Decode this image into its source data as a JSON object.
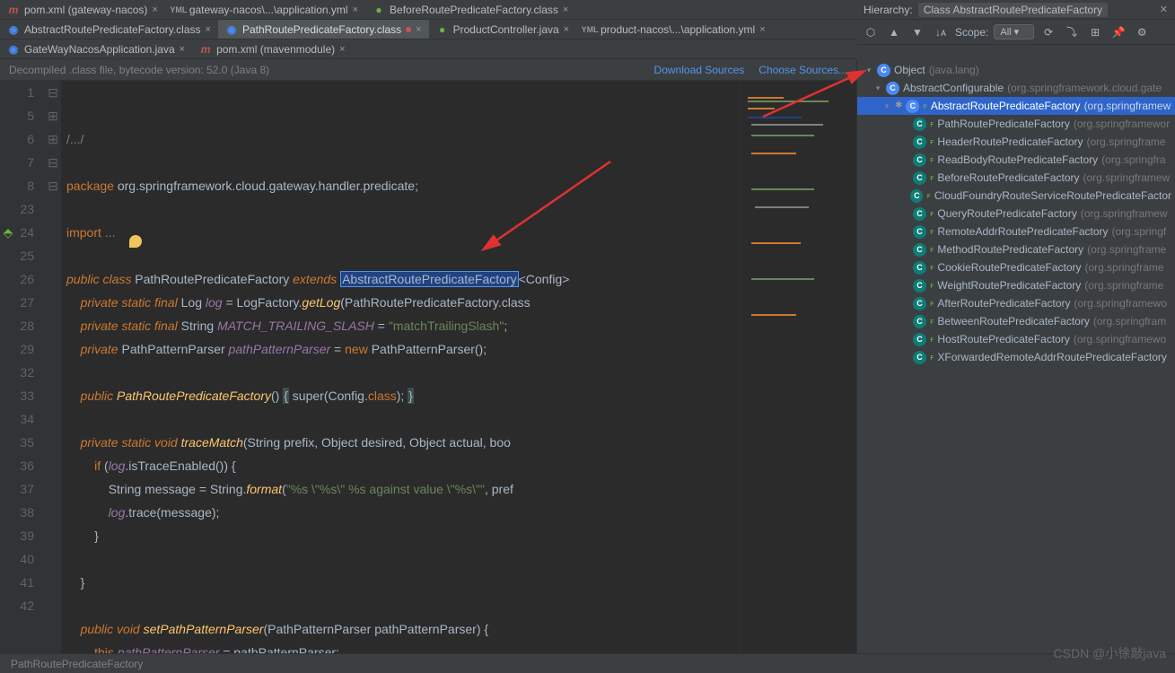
{
  "tabs_row1": [
    {
      "label": "pom.xml (gateway-nacos)",
      "icon": "m",
      "active": false
    },
    {
      "label": "gateway-nacos\\...\\application.yml",
      "icon": "y",
      "active": false
    },
    {
      "label": "BeforeRoutePredicateFactory.class",
      "icon": "j",
      "active": false
    }
  ],
  "tabs_row2": [
    {
      "label": "AbstractRoutePredicateFactory.class",
      "icon": "g",
      "active": false
    },
    {
      "label": "PathRoutePredicateFactory.class",
      "icon": "g",
      "active": true,
      "pinned": true
    },
    {
      "label": "ProductController.java",
      "icon": "j",
      "active": false
    },
    {
      "label": "product-nacos\\...\\application.yml",
      "icon": "y",
      "active": false
    }
  ],
  "tabs_row3": [
    {
      "label": "GateWayNacosApplication.java",
      "icon": "g",
      "active": false
    },
    {
      "label": "pom.xml (mavenmodule)",
      "icon": "m",
      "active": false
    }
  ],
  "info_bar": {
    "decompile_text": "Decompiled .class file, bytecode version: 52.0 (Java 8)",
    "download_sources": "Download Sources",
    "choose_sources": "Choose Sources..."
  },
  "line_numbers": [
    "1",
    "5",
    "6",
    "7",
    "8",
    "23",
    "24",
    "25",
    "26",
    "27",
    "28",
    "29",
    "32",
    "33",
    "34",
    "35",
    "36",
    "37",
    "38",
    "39",
    "40",
    "41",
    "42"
  ],
  "code": {
    "l1": "/.../",
    "l6_pkg": "package ",
    "l6_path": "org.springframework.cloud.gateway.handler.predicate;",
    "l8_imp": "import ",
    "l8_rest": "...",
    "l24_pub": "public class ",
    "l24_cls": "PathRoutePredicateFactory ",
    "l24_ext": "extends ",
    "l24_super": "AbstractRoutePredicateFactory",
    "l24_end": "<Config>",
    "l25_mod": "private static final ",
    "l25_type": "Log ",
    "l25_fld": "log",
    "l25_eq": " = LogFactory.",
    "l25_mth": "getLog",
    "l25_arg": "(PathRoutePredicateFactory.class",
    "l26_mod": "private static final ",
    "l26_type": "String ",
    "l26_fld": "MATCH_TRAILING_SLASH",
    "l26_eq": " = ",
    "l26_str": "\"matchTrailingSlash\"",
    "l26_end": ";",
    "l27_mod": "private ",
    "l27_type": "PathPatternParser ",
    "l27_fld": "pathPatternParser",
    "l27_eq": " = ",
    "l27_new": "new ",
    "l27_ctor": "PathPatternParser();",
    "l29_pub": "public ",
    "l29_nm": "PathRoutePredicateFactory",
    "l29_par": "() ",
    "l29_b1": "{",
    "l29_bod": " super(Config.",
    "l29_cls": "class",
    "l29_bod2": "); ",
    "l29_b2": "}",
    "l33_mod": "private static void ",
    "l33_nm": "traceMatch",
    "l33_args": "(String prefix, Object desired, Object actual, boo",
    "l34_if": "if ",
    "l34_cond1": "(",
    "l34_log": "log",
    "l34_cond2": ".isTraceEnabled()) {",
    "l35_lhs": "String message = String.",
    "l35_mth": "format",
    "l35_p1": "(",
    "l35_str": "\"%s \\\"%s\\\" %s against value \\\"%s\\\"\"",
    "l35_rest": ", pref",
    "l36_log": "log",
    "l36_rest": ".trace(message);",
    "l37_close": "}",
    "l39_close": "}",
    "l41_pub": "public void ",
    "l41_nm": "setPathPatternParser",
    "l41_args": "(PathPatternParser pathPatternParser) {",
    "l42_this": "this",
    "l42_dot": ".",
    "l42_fld": "pathPatternParser",
    "l42_rest": " = pathPatternParser;"
  },
  "hierarchy": {
    "title": "Hierarchy:",
    "class_label": "Class AbstractRoutePredicateFactory",
    "scope_label": "Scope:",
    "scope_value": "All",
    "tree": [
      {
        "indent": 0,
        "chev": "▾",
        "badge": "C",
        "badgeCls": "class",
        "name": "Object",
        "pkg": "(java.lang)"
      },
      {
        "indent": 1,
        "chev": "▾",
        "badge": "C",
        "badgeCls": "class",
        "name": "AbstractConfigurable",
        "pkg": "(org.springframework.cloud.gate"
      },
      {
        "indent": 2,
        "chev": "▾",
        "final": true,
        "selected": true,
        "badge": "C",
        "badgeCls": "class",
        "name": "AbstractRoutePredicateFactory",
        "pkg": "(org.springframew"
      },
      {
        "indent": 4,
        "badge": "C",
        "badgeCls": "class-c",
        "final": true,
        "name": "PathRoutePredicateFactory",
        "pkg": "(org.springframewor"
      },
      {
        "indent": 4,
        "badge": "C",
        "badgeCls": "class-c",
        "final": true,
        "name": "HeaderRoutePredicateFactory",
        "pkg": "(org.springframe"
      },
      {
        "indent": 4,
        "badge": "C",
        "badgeCls": "class-c",
        "final": true,
        "name": "ReadBodyRoutePredicateFactory",
        "pkg": "(org.springfra"
      },
      {
        "indent": 4,
        "badge": "C",
        "badgeCls": "class-c",
        "final": true,
        "name": "BeforeRoutePredicateFactory",
        "pkg": "(org.springframew"
      },
      {
        "indent": 4,
        "badge": "C",
        "badgeCls": "class-c",
        "final": true,
        "name": "CloudFoundryRouteServiceRoutePredicateFactor",
        "pkg": ""
      },
      {
        "indent": 4,
        "badge": "C",
        "badgeCls": "class-c",
        "final": true,
        "name": "QueryRoutePredicateFactory",
        "pkg": "(org.springframew"
      },
      {
        "indent": 4,
        "badge": "C",
        "badgeCls": "class-c",
        "final": true,
        "name": "RemoteAddrRoutePredicateFactory",
        "pkg": "(org.springf"
      },
      {
        "indent": 4,
        "badge": "C",
        "badgeCls": "class-c",
        "final": true,
        "name": "MethodRoutePredicateFactory",
        "pkg": "(org.springframe"
      },
      {
        "indent": 4,
        "badge": "C",
        "badgeCls": "class-c",
        "final": true,
        "name": "CookieRoutePredicateFactory",
        "pkg": "(org.springframe"
      },
      {
        "indent": 4,
        "badge": "C",
        "badgeCls": "class-c",
        "final": true,
        "name": "WeightRoutePredicateFactory",
        "pkg": "(org.springframe"
      },
      {
        "indent": 4,
        "badge": "C",
        "badgeCls": "class-c",
        "final": true,
        "name": "AfterRoutePredicateFactory",
        "pkg": "(org.springframewo"
      },
      {
        "indent": 4,
        "badge": "C",
        "badgeCls": "class-c",
        "final": true,
        "name": "BetweenRoutePredicateFactory",
        "pkg": "(org.springfram"
      },
      {
        "indent": 4,
        "badge": "C",
        "badgeCls": "class-c",
        "final": true,
        "name": "HostRoutePredicateFactory",
        "pkg": "(org.springframewo"
      },
      {
        "indent": 4,
        "badge": "C",
        "badgeCls": "class-c",
        "final": true,
        "name": "XForwardedRemoteAddrRoutePredicateFactory",
        "pkg": ""
      }
    ]
  },
  "breadcrumb": "PathRoutePredicateFactory",
  "watermark": "CSDN @小徐敲java"
}
